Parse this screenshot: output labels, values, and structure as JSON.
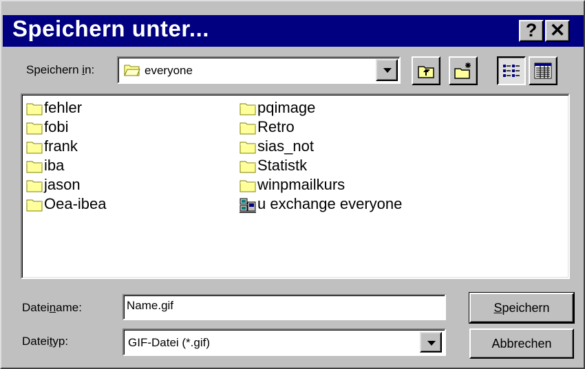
{
  "window": {
    "title": "Speichern unter...",
    "help_glyph": "?",
    "close_glyph": "✕"
  },
  "location": {
    "label_before": "Speichern ",
    "label_mnemonic": "i",
    "label_after": "n:",
    "value": "everyone"
  },
  "toolbar": [
    {
      "name": "up-one-level-icon"
    },
    {
      "name": "new-folder-icon"
    },
    {
      "name": "list-view-icon",
      "pressed": true
    },
    {
      "name": "details-view-icon"
    }
  ],
  "files": {
    "column1": [
      {
        "name": "fehler",
        "icon": "folder-icon"
      },
      {
        "name": "fobi",
        "icon": "folder-icon"
      },
      {
        "name": "frank",
        "icon": "folder-icon"
      },
      {
        "name": "iba",
        "icon": "folder-icon"
      },
      {
        "name": "jason",
        "icon": "folder-icon"
      },
      {
        "name": "Oea-ibea",
        "icon": "folder-icon"
      }
    ],
    "column2": [
      {
        "name": "pqimage",
        "icon": "folder-icon"
      },
      {
        "name": "Retro",
        "icon": "folder-icon"
      },
      {
        "name": "sias_not",
        "icon": "folder-icon"
      },
      {
        "name": "Statistk",
        "icon": "folder-icon"
      },
      {
        "name": "winpmailkurs",
        "icon": "folder-icon"
      },
      {
        "name": "u exchange everyone",
        "icon": "network-icon"
      }
    ]
  },
  "filename": {
    "label_before": "Datei",
    "label_mnemonic": "n",
    "label_after": "ame:",
    "value": "Name.gif"
  },
  "filetype": {
    "label_before": "Datei",
    "label_mnemonic": "t",
    "label_after": "yp:",
    "value": "GIF-Datei (*.gif)"
  },
  "buttons": {
    "save_mnemonic": "S",
    "save_rest": "peichern",
    "cancel": "Abbrechen"
  },
  "colors": {
    "titlebar": "#000080",
    "face": "#c0c0c0",
    "folder": "#ffff99"
  }
}
